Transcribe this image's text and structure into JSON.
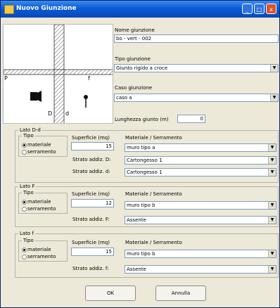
{
  "window": {
    "title": "Nuovo Giunzione",
    "min": "_",
    "max": "□",
    "close": "x"
  },
  "diagram": {
    "label_p": "P",
    "label_f": "f",
    "label_d": "D",
    "label_d2": "d"
  },
  "top_fields": {
    "nome_label": "Nome giunzione",
    "nome_value": "bo - vert - 002",
    "tipo_label": "Tipo giunzione",
    "tipo_value": "Giunto rigido a croce",
    "caso_label": "Caso giunzione",
    "caso_value": "caso a",
    "lunghezza_label": "Lunghezza giunto (m)",
    "lunghezza_value": "0"
  },
  "groups": [
    {
      "title": "Lato D-d",
      "tipo_title": "Tipo",
      "radio_materiale": "materiale",
      "radio_serramento": "serramento",
      "superficie_label": "Superficie (mq)",
      "superficie_value": "15",
      "materiale_label": "Materiale / Serramento",
      "materiale_value": "muro tipo a",
      "strato1_label": "Strato addiz. D:",
      "strato1_value": "Cartongesso 1",
      "strato2_label": "Strato addiz. d:",
      "strato2_value": "Cartongesso 1"
    },
    {
      "title": "Lato F",
      "tipo_title": "Tipo",
      "radio_materiale": "materiale",
      "radio_serramento": "serramento",
      "superficie_label": "Superficie (mq)",
      "superficie_value": "12",
      "materiale_label": "Materiale / Serramento",
      "materiale_value": "muro tipo b",
      "strato1_label": "Strato addiz. F:",
      "strato1_value": "Assente"
    },
    {
      "title": "Lato f",
      "tipo_title": "Tipo",
      "radio_materiale": "materiale",
      "radio_serramento": "serramento",
      "superficie_label": "Superficie (mq)",
      "superficie_value": "15",
      "materiale_label": "Materiale / Serramento",
      "materiale_value": "muro tipo b",
      "strato1_label": "Strato addiz. f:",
      "strato1_value": "Assente"
    }
  ],
  "buttons": {
    "ok": "OK",
    "cancel": "Annulla"
  },
  "dropdown_arrow": "▼"
}
